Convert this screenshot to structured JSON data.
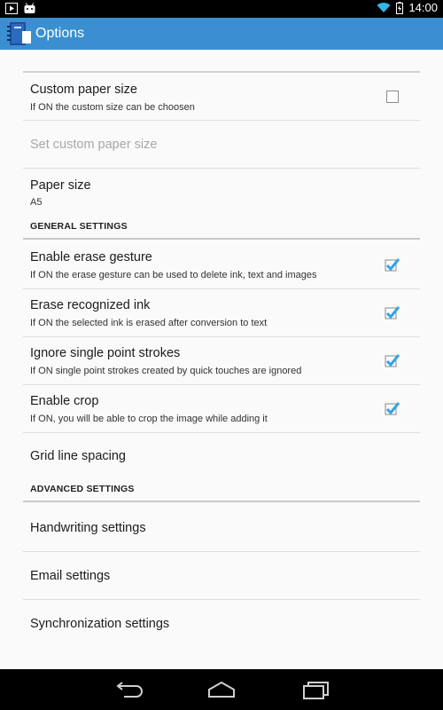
{
  "status_bar": {
    "time": "14:00",
    "icons": [
      "play-store-icon",
      "android-debug-icon",
      "wifi-icon",
      "battery-charging-icon"
    ]
  },
  "action_bar": {
    "title": "Options",
    "icon": "app-notebook-icon"
  },
  "colors": {
    "action_bar": "#3a8fd1",
    "check_accent": "#33a4e3",
    "status_bar": "#000000",
    "nav_bar": "#000000"
  },
  "items": {
    "custom_paper_size": {
      "title": "Custom paper size",
      "summary": "If ON the custom size can be choosen",
      "checked": false
    },
    "set_custom_paper_size": {
      "title": "Set custom paper size",
      "enabled": false
    },
    "paper_size": {
      "title": "Paper size",
      "summary": "A5"
    }
  },
  "general": {
    "header": "GENERAL SETTINGS",
    "enable_erase_gesture": {
      "title": "Enable erase gesture",
      "summary": "If ON the erase gesture can be used to delete ink, text and images",
      "checked": true
    },
    "erase_recognized_ink": {
      "title": "Erase recognized ink",
      "summary": "If ON the selected ink is erased after conversion to text",
      "checked": true
    },
    "ignore_single_point": {
      "title": "Ignore single point strokes",
      "summary": "If ON single point strokes created by quick touches are ignored",
      "checked": true
    },
    "enable_crop": {
      "title": "Enable crop",
      "summary": "If ON, you will be able to crop the image while adding it",
      "checked": true
    },
    "grid_line_spacing": {
      "title": "Grid line spacing"
    }
  },
  "advanced": {
    "header": "ADVANCED SETTINGS",
    "handwriting": {
      "title": "Handwriting settings"
    },
    "email": {
      "title": "Email settings"
    },
    "synchronization": {
      "title": "Synchronization settings"
    }
  },
  "nav": {
    "icons": [
      "back-icon",
      "home-icon",
      "recent-apps-icon"
    ]
  }
}
